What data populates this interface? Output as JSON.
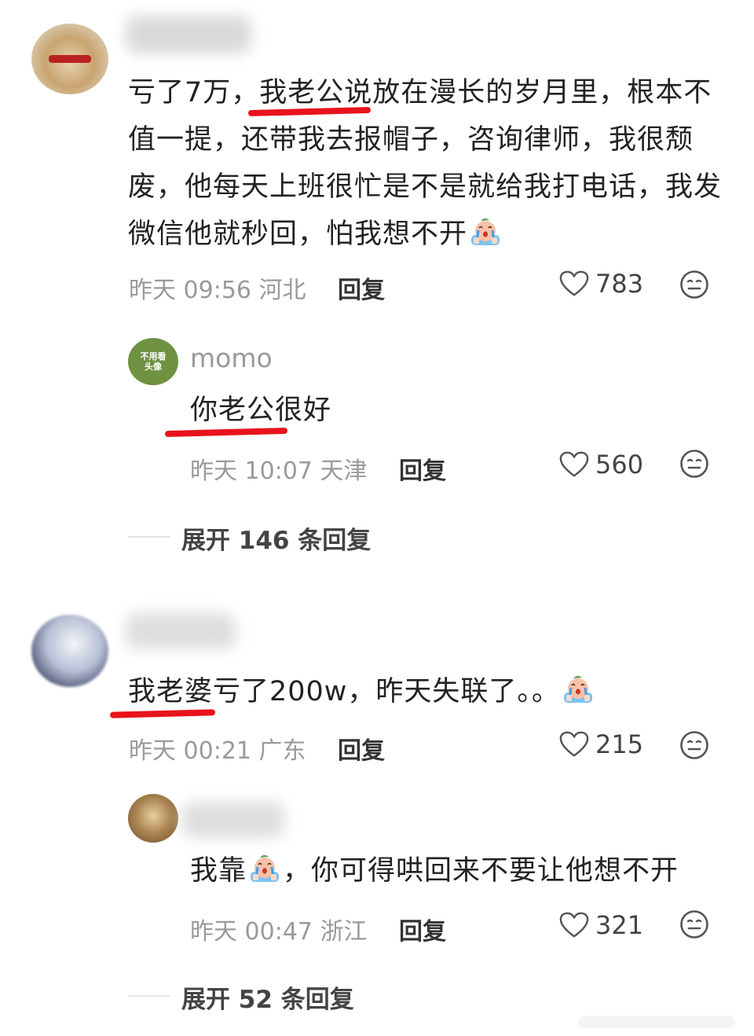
{
  "comments": [
    {
      "text": "亏了7万，我老公说放在漫长的岁月里，根本不值一提，还带我去报帽子，咨询律师，我很颓废，他每天上班很忙是不是就给我打电话，我发微信他就秒回，怕我想不开",
      "emoji": "crying-emoji",
      "meta": "昨天 09:56 河北",
      "reply_label": "回复",
      "likes": "783",
      "reply": {
        "name": "momo",
        "avatar_text": "不用看头像",
        "text": "你老公很好",
        "meta": "昨天 10:07 天津",
        "reply_label": "回复",
        "likes": "560"
      },
      "expand_label": "展开 146 条回复"
    },
    {
      "text": "我老婆亏了200w，昨天失联了。。",
      "emoji": "crying-emoji",
      "meta": "昨天 00:21 广东",
      "reply_label": "回复",
      "likes": "215",
      "reply": {
        "text_before": "我靠",
        "text_after": "，你可得哄回来不要让他想不开",
        "meta": "昨天 00:47 浙江",
        "reply_label": "回复",
        "likes": "321"
      },
      "expand_label": "展开 52 条回复"
    }
  ],
  "colors": {
    "accent_underline": "#e8131c",
    "meta_gray": "#9a9a9a"
  }
}
